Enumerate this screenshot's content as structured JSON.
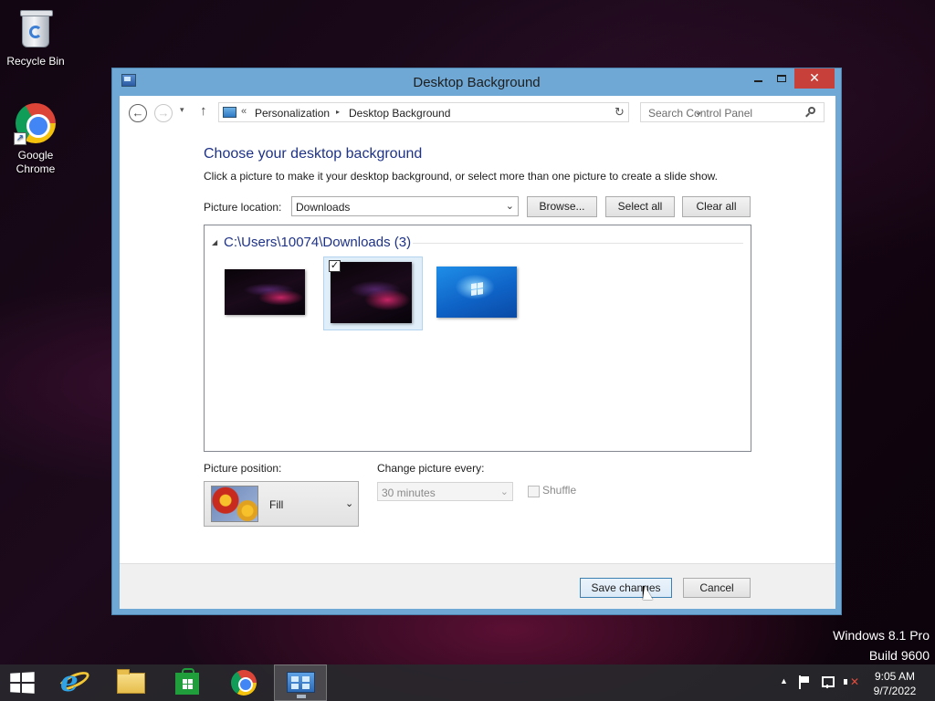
{
  "desktop": {
    "icons": [
      {
        "label": "Recycle Bin",
        "icon": "recycle-bin-icon"
      },
      {
        "label": "Google\nChrome",
        "icon": "chrome-icon"
      }
    ]
  },
  "window": {
    "title": "Desktop Background",
    "controls": {
      "minimize": "minimize",
      "maximize": "maximize",
      "close": "✕"
    }
  },
  "navbar": {
    "back": "←",
    "forward": "→",
    "recent": "▾",
    "up": "↑",
    "crumb_prefix": "«",
    "breadcrumbs": [
      "Personalization",
      "Desktop Background"
    ],
    "crumb_separator": "▸",
    "dropdown": "⌄",
    "refresh": "↻",
    "search_placeholder": "Search Control Panel"
  },
  "content": {
    "heading": "Choose your desktop background",
    "description": "Click a picture to make it your desktop background, or select more than one picture to create a slide show.",
    "picture_location_label": "Picture location:",
    "picture_location_value": "Downloads",
    "browse_label": "Browse...",
    "select_all_label": "Select all",
    "clear_all_label": "Clear all",
    "group": {
      "toggle": "◢",
      "title": "C:\\Users\\10074\\Downloads (3)",
      "pictures": [
        {
          "name": "dark-wallpaper-1",
          "selected": false,
          "checked": false
        },
        {
          "name": "dark-wallpaper-2",
          "selected": true,
          "checked": true
        },
        {
          "name": "windows-blue-wallpaper",
          "selected": false,
          "checked": false
        }
      ]
    },
    "checkmark": "✓",
    "picture_position_label": "Picture position:",
    "picture_position_value": "Fill",
    "change_every_label": "Change picture every:",
    "change_every_value": "30 minutes",
    "shuffle_label": "Shuffle",
    "shuffle_checked": false,
    "select_arrow": "⌄"
  },
  "footer": {
    "save_label": "Save changes",
    "cancel_label": "Cancel"
  },
  "watermark": {
    "line1": "Windows 8.1 Pro",
    "line2": "Build 9600"
  },
  "taskbar": {
    "apps": [
      "internet-explorer",
      "file-explorer",
      "store",
      "chrome",
      "control-panel"
    ],
    "active_app": "control-panel",
    "tray_up": "▲",
    "time": "9:05 AM",
    "date": "9/7/2022"
  },
  "colors": {
    "accent_blue": "#6fa8d4",
    "heading_blue": "#1e3287",
    "close_red": "#c7413a",
    "selection_fill": "#e0eef9"
  }
}
